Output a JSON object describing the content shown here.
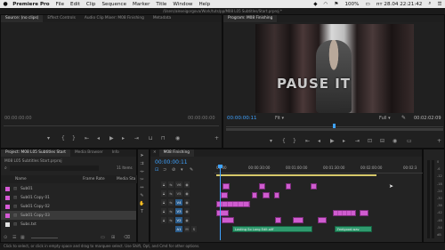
{
  "menubar": {
    "apple": "",
    "items": [
      "Premiere Pro",
      "File",
      "Edit",
      "Clip",
      "Sequence",
      "Marker",
      "Title",
      "Window",
      "Help"
    ],
    "status": {
      "battery": "100%",
      "clock": "пт 28.04  22:21:42",
      "icons": [
        "dropbox-icon",
        "wifi-icon",
        "flag-icon",
        "search-icon",
        "menu-icon"
      ]
    }
  },
  "titlebar": {
    "path": "/Users/alexeigorgova/Work/tuts/pp/M08 L05 Subtitles/Start.prproj *"
  },
  "source_panel": {
    "tabs": [
      "Source: (no clips)",
      "Effect Controls",
      "Audio Clip Mixer: M08 Finishing",
      "Metadata"
    ],
    "timecode_left": "00:00:00:00",
    "timecode_right": "00:00:00:00"
  },
  "program_panel": {
    "title": "Program: M08 Finishing",
    "video_text": "PAUSE IT",
    "timecode": "00:00:00:11",
    "fit": "Fit",
    "quality": "Full",
    "duration": "00:02:02:09"
  },
  "project_panel": {
    "tabs": [
      "Project: M08 L05 Subtitles Start",
      "Media Browser",
      "Info"
    ],
    "file": "M08 L05 Subtitles Start.prproj",
    "count": "11 Items",
    "columns": {
      "name": "Name",
      "frame_rate": "Frame Rate",
      "media": "Media Sta"
    },
    "items": [
      {
        "name": "Sub01",
        "color": "#d55ad5"
      },
      {
        "name": "Sub01 Copy 01",
        "color": "#d55ad5"
      },
      {
        "name": "Sub01 Copy 02",
        "color": "#d55ad5"
      },
      {
        "name": "Sub01 Copy 03",
        "color": "#d55ad5"
      },
      {
        "name": "Subs.txt",
        "color": "#e0e0e0"
      }
    ]
  },
  "timeline_panel": {
    "tab": "M08 Finishing",
    "timecode": "00:00:00:11",
    "ruler": [
      "00:00",
      "00:00:30:00",
      "00:01:00:00",
      "00:01:30:00",
      "00:02:00:00",
      "00:02:3"
    ],
    "tracks": [
      "V6",
      "V5",
      "V4",
      "V3",
      "V2",
      "V1",
      "A1",
      "A2"
    ],
    "audio_clips": [
      "Lasting So Long Edit.aiff",
      "Feelgood.wav"
    ],
    "meter_labels": [
      "0",
      "-6",
      "-12",
      "-18",
      "-24",
      "-30",
      "-36",
      "-42",
      "-48",
      "-54",
      "dB"
    ]
  },
  "status_bar": {
    "text": "Click to select, or click in empty space and drag to marquee select. Use Shift, Opt, and Cmd for other options."
  },
  "colors": {
    "accent": "#3fa3ff",
    "video_clip": "#cf5ccf",
    "audio_clip": "#2f9a6e",
    "playhead": "#3fa3ff"
  }
}
